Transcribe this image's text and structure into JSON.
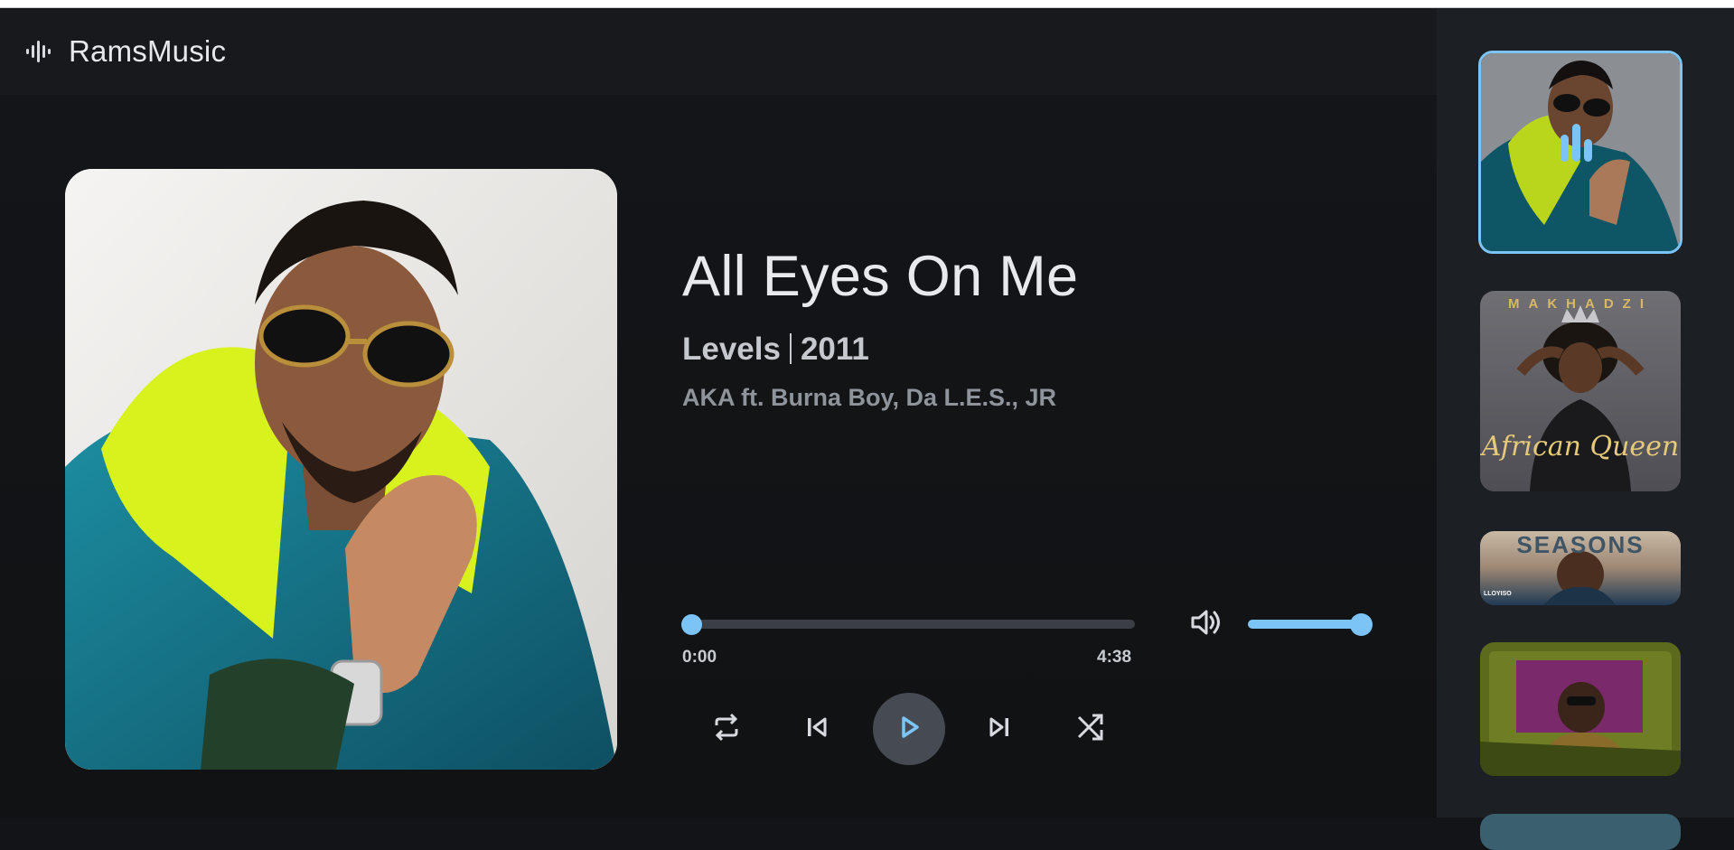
{
  "app": {
    "name": "RamsMusic",
    "logo_icon": "waveform-icon"
  },
  "now_playing": {
    "title": "All Eyes On Me",
    "album": "Levels",
    "year": "2011",
    "artists": "AKA ft. Burna Boy, Da L.E.S., JR",
    "cover_icon": "album-cover-image",
    "playing_indicator_icon": "equalizer-bars-icon"
  },
  "playback": {
    "current_time": "0:00",
    "total_time": "4:38",
    "progress_fraction": 0.0,
    "volume_fraction": 1.0
  },
  "controls": {
    "repeat_icon": "repeat-icon",
    "previous_icon": "skip-previous-icon",
    "play_icon": "play-icon",
    "next_icon": "skip-next-icon",
    "shuffle_icon": "shuffle-icon",
    "volume_icon": "volume-icon"
  },
  "queue": {
    "items": [
      {
        "id": "all-eyes-on-me",
        "active": true
      },
      {
        "id": "african-queen",
        "top_text": "MAKHADZI",
        "cover_text": "African Queen",
        "active": false
      },
      {
        "id": "seasons",
        "top_text": "SEASONS",
        "small_text": "LLOYISO",
        "active": false
      },
      {
        "id": "car-cover",
        "active": false
      },
      {
        "id": "partial-cover",
        "active": false
      }
    ]
  },
  "colors": {
    "accent": "#7cc4f5",
    "background": "#121417",
    "header": "#17191c",
    "sidebar": "#1c1f23",
    "play_button": "#464b53"
  }
}
